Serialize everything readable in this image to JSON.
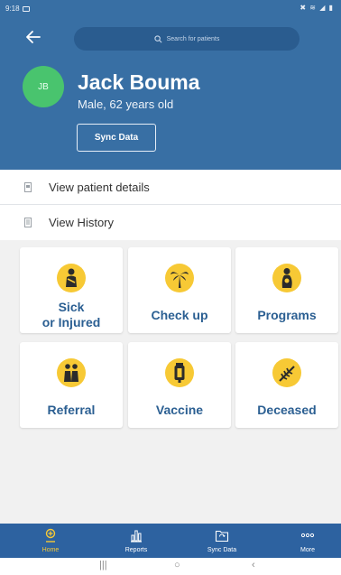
{
  "status_bar": {
    "time": "9:18",
    "icons": "✖ ≋ ◢ ▮"
  },
  "search": {
    "placeholder": "Search for patients"
  },
  "patient": {
    "initials": "JB",
    "name": "Jack Bouma",
    "sub": "Male, 62 years old",
    "sync_label": "Sync Data"
  },
  "menu": {
    "details_label": "View patient details",
    "history_label": "View History"
  },
  "tiles": [
    {
      "line1": "Sick",
      "line2": "or Injured",
      "icon": "sick-injured-icon"
    },
    {
      "line1": "Check up",
      "icon": "palm-tree-icon"
    },
    {
      "line1": "Programs",
      "icon": "programs-icon"
    },
    {
      "line1": "Referral",
      "icon": "referral-icon"
    },
    {
      "line1": "Vaccine",
      "icon": "vaccine-icon"
    },
    {
      "line1": "Deceased",
      "icon": "deceased-icon"
    }
  ],
  "nav": {
    "items": [
      {
        "label": "Home",
        "icon": "home-icon",
        "active": true
      },
      {
        "label": "Reports",
        "icon": "reports-icon",
        "active": false
      },
      {
        "label": "Sync Data",
        "icon": "sync-icon",
        "active": false
      },
      {
        "label": "More",
        "icon": "more-icon",
        "active": false
      }
    ]
  },
  "system_nav": {
    "recents": "|||",
    "home": "○",
    "back": "‹"
  },
  "colors": {
    "header": "#386fa4",
    "avatar": "#49c46e",
    "tile_text": "#2b5f92",
    "icon_circle": "#f7c935",
    "nav_bg": "#2d62a0",
    "nav_active": "#f7c935"
  }
}
